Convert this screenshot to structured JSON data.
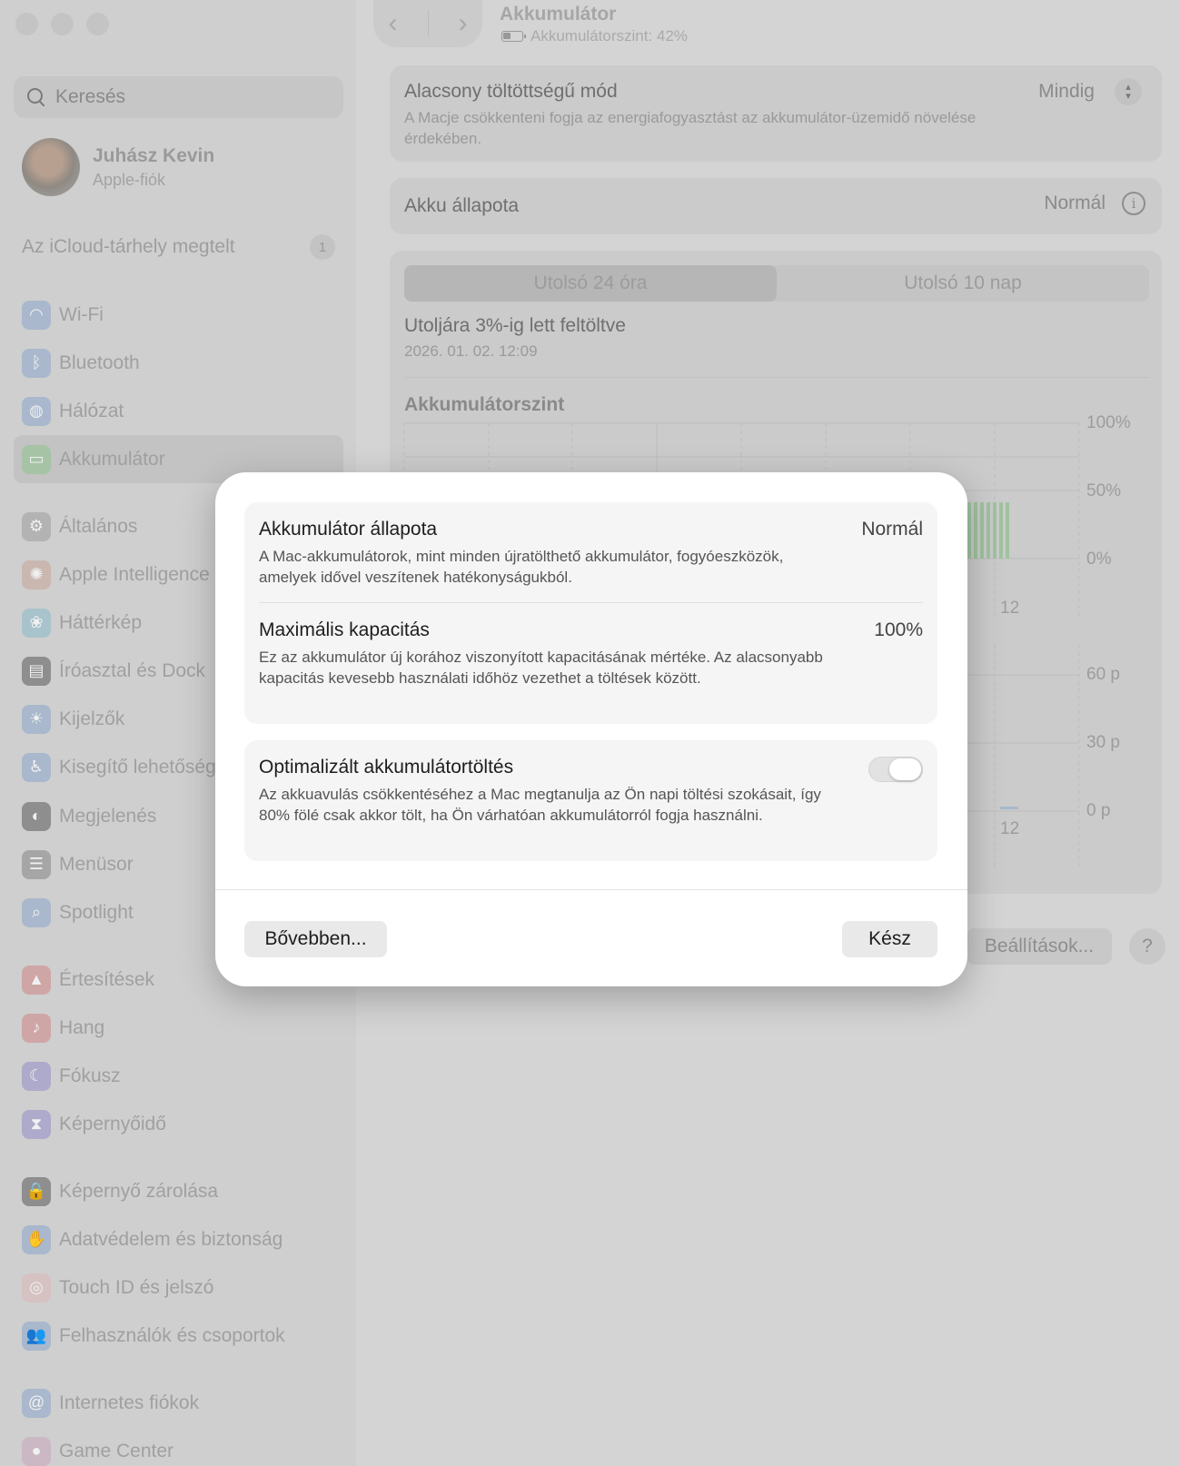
{
  "sidebar": {
    "search_placeholder": "Keresés",
    "profile": {
      "name": "Juhász Kevin",
      "subtitle": "Apple-fiók"
    },
    "icloud": {
      "label": "Az iCloud-tárhely megtelt",
      "badge": "1"
    },
    "items": [
      {
        "label": "Wi-Fi",
        "icon": "wifi-icon",
        "color": "#a9b8cc"
      },
      {
        "label": "Bluetooth",
        "icon": "bluetooth-icon",
        "color": "#a9b8cc"
      },
      {
        "label": "Hálózat",
        "icon": "globe-icon",
        "color": "#a9b8cc"
      },
      {
        "label": "Akkumulátor",
        "icon": "battery-icon",
        "color": "#a6c3a6",
        "selected": true
      },
      {
        "label": "Általános",
        "icon": "gear-icon",
        "color": "#b3b3b3"
      },
      {
        "label": "Apple Intelligence",
        "icon": "apple-intelligence-icon",
        "color": "#c9b7b0"
      },
      {
        "label": "Háttérkép",
        "icon": "wallpaper-icon",
        "color": "#a9c3cc"
      },
      {
        "label": "Íróasztal és Dock",
        "icon": "dock-icon",
        "color": "#8e8e8e"
      },
      {
        "label": "Kijelzők",
        "icon": "display-icon",
        "color": "#a9b8cc"
      },
      {
        "label": "Kisegítő lehetőségek",
        "icon": "accessibility-icon",
        "color": "#a9b8cc"
      },
      {
        "label": "Megjelenés",
        "icon": "appearance-icon",
        "color": "#8e8e8e"
      },
      {
        "label": "Menüsor",
        "icon": "menubar-icon",
        "color": "#a6a6a6"
      },
      {
        "label": "Spotlight",
        "icon": "spotlight-icon",
        "color": "#a9b8cc"
      },
      {
        "label": "Értesítések",
        "icon": "notifications-icon",
        "color": "#cfa6a6"
      },
      {
        "label": "Hang",
        "icon": "sound-icon",
        "color": "#cfa6a6"
      },
      {
        "label": "Fókusz",
        "icon": "focus-icon",
        "color": "#aeaacb"
      },
      {
        "label": "Képernyőidő",
        "icon": "screen-time-icon",
        "color": "#aeaacb"
      },
      {
        "label": "Képernyő zárolása",
        "icon": "lock-icon",
        "color": "#8e8e8e"
      },
      {
        "label": "Adatvédelem és biztonság",
        "icon": "privacy-hand-icon",
        "color": "#a9b8cc"
      },
      {
        "label": "Touch ID és jelszó",
        "icon": "fingerprint-icon",
        "color": "#d6c2c2"
      },
      {
        "label": "Felhasználók és csoportok",
        "icon": "users-icon",
        "color": "#a9b8cc"
      },
      {
        "label": "Internetes fiókok",
        "icon": "at-icon",
        "color": "#a9b8cc"
      },
      {
        "label": "Game Center",
        "icon": "game-center-icon",
        "color": "#cbb8c4"
      }
    ]
  },
  "header": {
    "title": "Akkumulátor",
    "battery_level": "Akkumulátorszint: 42%",
    "back_icon": "chevron-left-icon",
    "forward_icon": "chevron-right-icon"
  },
  "main": {
    "low_power": {
      "label": "Alacsony töltöttségű mód",
      "description": "A Macje csökkenteni fogja az energiafogyasztást az akkumulátor-üzemidő növelése érdekében.",
      "value": "Mindig"
    },
    "health": {
      "label": "Akku állapota",
      "value": "Normál"
    },
    "tabs": [
      {
        "label": "Utolsó 24 óra",
        "selected": true
      },
      {
        "label": "Utolsó 10 nap",
        "selected": false
      }
    ],
    "last_charged": {
      "label": "Utoljára 3%-ig lett feltöltve",
      "time": "2026. 01. 02. 12:09"
    },
    "chart_title": "Akkumulátorszint",
    "level_ticks": [
      "100%",
      "50%",
      "0%"
    ],
    "level_x_tick": "12",
    "usage_ticks": [
      "60 p",
      "30 p",
      "0 p"
    ],
    "usage_x_tick": "12",
    "options_button": "Beállítások...",
    "help_button": "?"
  },
  "dialog": {
    "health": {
      "label": "Akkumulátor állapota",
      "value": "Normál",
      "description": "A Mac-akkumulátorok, mint minden újratölthető akkumulátor, fogyóeszközök, amelyek idővel veszítenek hatékonyságukból."
    },
    "capacity": {
      "label": "Maximális kapacitás",
      "value": "100%",
      "description": "Ez az akkumulátor új korához viszonyított kapacitásának mértéke. Az alacsonyabb kapacitás kevesebb használati időhöz vezethet a töltések között."
    },
    "optimized": {
      "label": "Optimalizált akkumulátortöltés",
      "description": "Az akkuavulás csökkentéséhez a Mac megtanulja az Ön napi töltési szokásait, így 80% fölé csak akkor tölt, ha Ön várhatóan akkumulátorról fogja használni.",
      "enabled": true
    },
    "learn_more": "Bővebben...",
    "done": "Kész"
  }
}
